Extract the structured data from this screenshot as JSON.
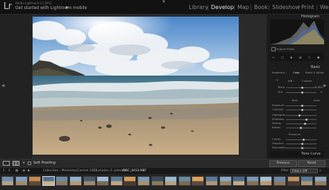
{
  "app": {
    "logo": "Lr",
    "version": "Adobe Lightroom CC 2015",
    "mobile_prompt": "Get started with Lightroom mobile",
    "mobile_arrow": "▶"
  },
  "modules": [
    "Library",
    "Develop",
    "Map",
    "Book",
    "Slideshow",
    "Print",
    "Web"
  ],
  "active_module": "Develop",
  "right_panel": {
    "histogram_title": "Histogram",
    "original_photo": "Original Photo",
    "basic_title": "Basic",
    "treatment_label": "Treatment :",
    "color_label": "Color",
    "bw_label": "Black & White",
    "wb_label": "WB :",
    "wb_value": "Custom",
    "temp_label": "Temp",
    "temp_value": "5,600",
    "tint_label": "Tint",
    "tint_value": "0",
    "tone_label": "Tone",
    "auto_label": "Auto",
    "exposure_label": "Exposure",
    "contrast_label": "Contrast",
    "highlights_label": "Highlights",
    "shadows_label": "Shadows",
    "whites_label": "Whites",
    "blacks_label": "Blacks",
    "presence_label": "Presence",
    "clarity_label": "Clarity",
    "vibrance_label": "Vibrance",
    "saturation_label": "Saturation",
    "tonecurve_title": "Tone Curve"
  },
  "toolbar": {
    "soft_proofing": "Soft Proofing",
    "previous": "Previous",
    "reset": "Reset"
  },
  "filmstrip": {
    "page1": "1",
    "page2": "2",
    "collection": "Collection : Monterey/Carmel 2015",
    "count": "27 photos /1 selected",
    "filename": "/DSC_8433.NEF",
    "filter_label": "Filter :",
    "filter_value": "Filters Off"
  },
  "colors": {
    "active_module": "#e8e8e8",
    "inactive_module": "#8a8a8a",
    "panel_bg": "#1c1c1c",
    "topbar_bg": "#121212"
  }
}
